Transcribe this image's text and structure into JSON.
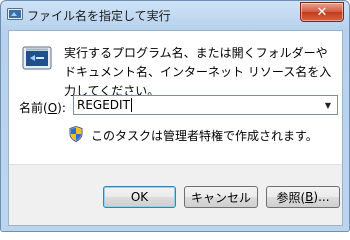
{
  "window": {
    "title": "ファイル名を指定して実行",
    "close_symbol": "✕"
  },
  "dialog": {
    "description": "実行するプログラム名、または開くフォルダーやドキュメント名、インターネット リソース名を入力してください。",
    "name_label_prefix": "名前(",
    "name_label_key": "O",
    "name_label_suffix": "):",
    "input_value": "REGEDIT",
    "admin_note": "このタスクは管理者特権で作成されます。"
  },
  "buttons": {
    "ok": "OK",
    "cancel": "キャンセル",
    "browse_prefix": "参照(",
    "browse_key": "B",
    "browse_suffix": ")..."
  },
  "icons": {
    "title": "run-app-icon",
    "main": "run-dialog-icon",
    "shield": "uac-shield-icon",
    "dropdown": "chevron-down-icon"
  },
  "colors": {
    "title_gradient_top": "#cfe3f6",
    "close_button": "#c13b1c",
    "default_button_border": "#3c7fb1"
  }
}
